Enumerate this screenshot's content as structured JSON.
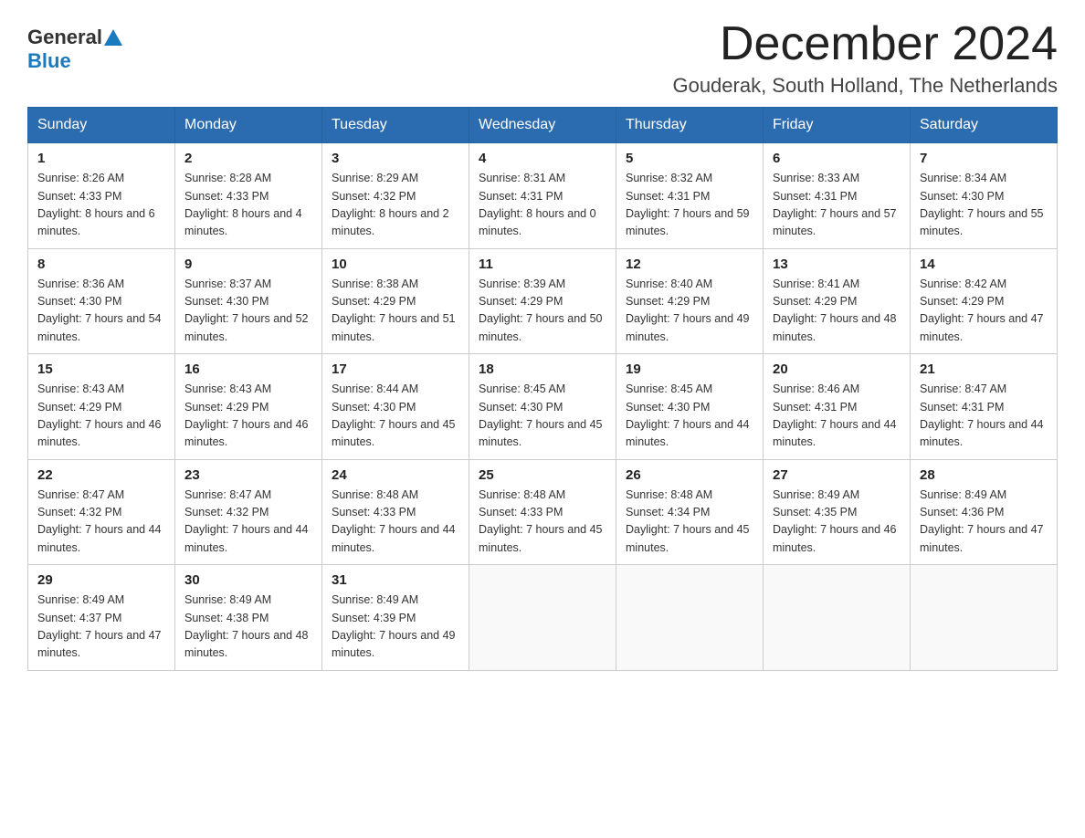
{
  "logo": {
    "general": "General",
    "blue": "Blue"
  },
  "header": {
    "month_year": "December 2024",
    "location": "Gouderak, South Holland, The Netherlands"
  },
  "days_of_week": [
    "Sunday",
    "Monday",
    "Tuesday",
    "Wednesday",
    "Thursday",
    "Friday",
    "Saturday"
  ],
  "weeks": [
    [
      {
        "day": "1",
        "sunrise": "8:26 AM",
        "sunset": "4:33 PM",
        "daylight": "8 hours and 6 minutes."
      },
      {
        "day": "2",
        "sunrise": "8:28 AM",
        "sunset": "4:33 PM",
        "daylight": "8 hours and 4 minutes."
      },
      {
        "day": "3",
        "sunrise": "8:29 AM",
        "sunset": "4:32 PM",
        "daylight": "8 hours and 2 minutes."
      },
      {
        "day": "4",
        "sunrise": "8:31 AM",
        "sunset": "4:31 PM",
        "daylight": "8 hours and 0 minutes."
      },
      {
        "day": "5",
        "sunrise": "8:32 AM",
        "sunset": "4:31 PM",
        "daylight": "7 hours and 59 minutes."
      },
      {
        "day": "6",
        "sunrise": "8:33 AM",
        "sunset": "4:31 PM",
        "daylight": "7 hours and 57 minutes."
      },
      {
        "day": "7",
        "sunrise": "8:34 AM",
        "sunset": "4:30 PM",
        "daylight": "7 hours and 55 minutes."
      }
    ],
    [
      {
        "day": "8",
        "sunrise": "8:36 AM",
        "sunset": "4:30 PM",
        "daylight": "7 hours and 54 minutes."
      },
      {
        "day": "9",
        "sunrise": "8:37 AM",
        "sunset": "4:30 PM",
        "daylight": "7 hours and 52 minutes."
      },
      {
        "day": "10",
        "sunrise": "8:38 AM",
        "sunset": "4:29 PM",
        "daylight": "7 hours and 51 minutes."
      },
      {
        "day": "11",
        "sunrise": "8:39 AM",
        "sunset": "4:29 PM",
        "daylight": "7 hours and 50 minutes."
      },
      {
        "day": "12",
        "sunrise": "8:40 AM",
        "sunset": "4:29 PM",
        "daylight": "7 hours and 49 minutes."
      },
      {
        "day": "13",
        "sunrise": "8:41 AM",
        "sunset": "4:29 PM",
        "daylight": "7 hours and 48 minutes."
      },
      {
        "day": "14",
        "sunrise": "8:42 AM",
        "sunset": "4:29 PM",
        "daylight": "7 hours and 47 minutes."
      }
    ],
    [
      {
        "day": "15",
        "sunrise": "8:43 AM",
        "sunset": "4:29 PM",
        "daylight": "7 hours and 46 minutes."
      },
      {
        "day": "16",
        "sunrise": "8:43 AM",
        "sunset": "4:29 PM",
        "daylight": "7 hours and 46 minutes."
      },
      {
        "day": "17",
        "sunrise": "8:44 AM",
        "sunset": "4:30 PM",
        "daylight": "7 hours and 45 minutes."
      },
      {
        "day": "18",
        "sunrise": "8:45 AM",
        "sunset": "4:30 PM",
        "daylight": "7 hours and 45 minutes."
      },
      {
        "day": "19",
        "sunrise": "8:45 AM",
        "sunset": "4:30 PM",
        "daylight": "7 hours and 44 minutes."
      },
      {
        "day": "20",
        "sunrise": "8:46 AM",
        "sunset": "4:31 PM",
        "daylight": "7 hours and 44 minutes."
      },
      {
        "day": "21",
        "sunrise": "8:47 AM",
        "sunset": "4:31 PM",
        "daylight": "7 hours and 44 minutes."
      }
    ],
    [
      {
        "day": "22",
        "sunrise": "8:47 AM",
        "sunset": "4:32 PM",
        "daylight": "7 hours and 44 minutes."
      },
      {
        "day": "23",
        "sunrise": "8:47 AM",
        "sunset": "4:32 PM",
        "daylight": "7 hours and 44 minutes."
      },
      {
        "day": "24",
        "sunrise": "8:48 AM",
        "sunset": "4:33 PM",
        "daylight": "7 hours and 44 minutes."
      },
      {
        "day": "25",
        "sunrise": "8:48 AM",
        "sunset": "4:33 PM",
        "daylight": "7 hours and 45 minutes."
      },
      {
        "day": "26",
        "sunrise": "8:48 AM",
        "sunset": "4:34 PM",
        "daylight": "7 hours and 45 minutes."
      },
      {
        "day": "27",
        "sunrise": "8:49 AM",
        "sunset": "4:35 PM",
        "daylight": "7 hours and 46 minutes."
      },
      {
        "day": "28",
        "sunrise": "8:49 AM",
        "sunset": "4:36 PM",
        "daylight": "7 hours and 47 minutes."
      }
    ],
    [
      {
        "day": "29",
        "sunrise": "8:49 AM",
        "sunset": "4:37 PM",
        "daylight": "7 hours and 47 minutes."
      },
      {
        "day": "30",
        "sunrise": "8:49 AM",
        "sunset": "4:38 PM",
        "daylight": "7 hours and 48 minutes."
      },
      {
        "day": "31",
        "sunrise": "8:49 AM",
        "sunset": "4:39 PM",
        "daylight": "7 hours and 49 minutes."
      },
      null,
      null,
      null,
      null
    ]
  ]
}
